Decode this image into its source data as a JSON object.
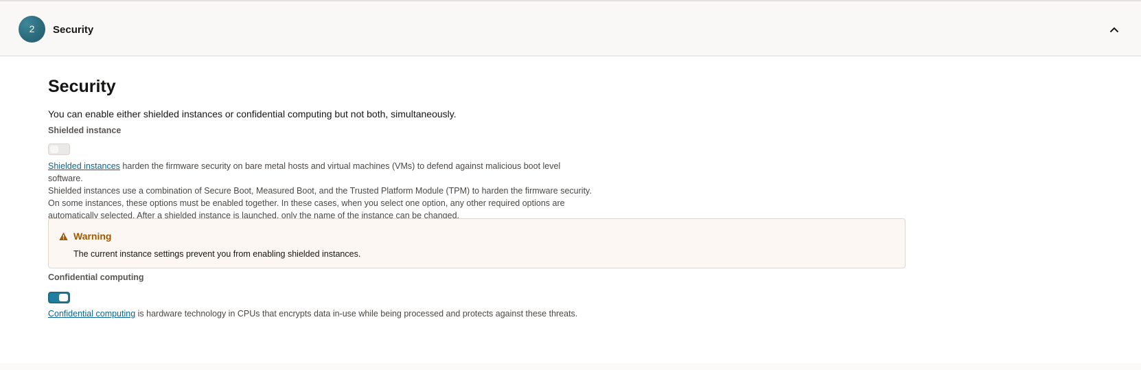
{
  "step": {
    "number": "2",
    "title": "Security",
    "collapse_icon": "chevron-up-icon"
  },
  "section": {
    "title": "Security",
    "intro": "You can enable either shielded instances or confidential computing but not both, simultaneously."
  },
  "shielded": {
    "label": "Shielded instance",
    "toggle_on": false,
    "link_text": "Shielded instances",
    "desc_line1": " harden the firmware security on bare metal hosts and virtual machines (VMs) to defend against malicious boot level software.",
    "desc_rest": "Shielded instances use a combination of Secure Boot, Measured Boot, and the Trusted Platform Module (TPM) to harden the firmware security. On some instances, these options must be enabled together. In these cases, when you select one option, any other required options are automatically selected. After a shielded instance is launched, only the name of the instance can be changed."
  },
  "warning": {
    "icon": "warning-triangle-icon",
    "title": "Warning",
    "text": "The current instance settings prevent you from enabling shielded instances."
  },
  "confidential": {
    "label": "Confidential computing",
    "toggle_on": true,
    "link_text": "Confidential computing",
    "desc": " is hardware technology in CPUs that encrypts data in-use while being processed and protects against these threats."
  },
  "colors": {
    "accent": "#227e9e",
    "link": "#0a6590",
    "warning": "#a15800",
    "step_badge": "#2a6a7c"
  }
}
